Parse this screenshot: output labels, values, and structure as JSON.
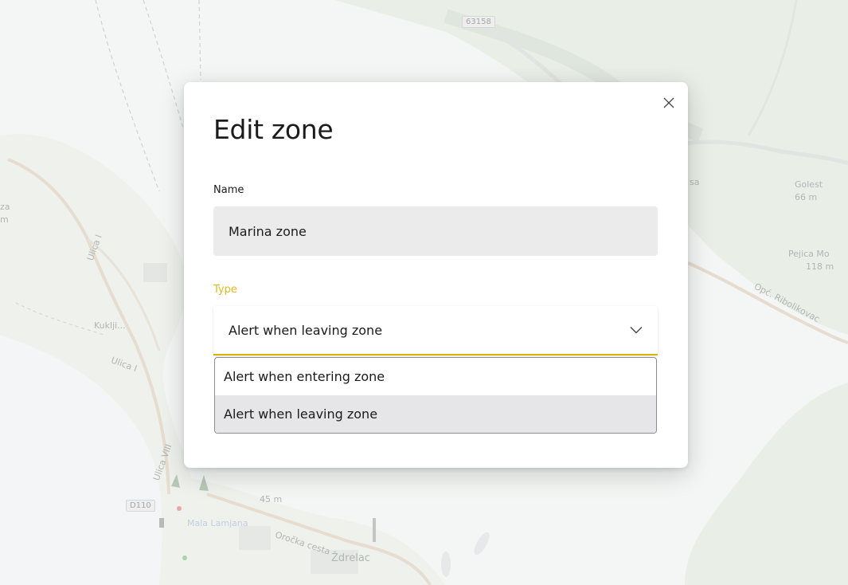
{
  "map": {
    "labels": {
      "road_63158": "63158",
      "kuklijca": "Kuklji...",
      "ulica_1": "Ulica I",
      "ulica_2": "Ulica I",
      "ulica_3": "Ulica VIII",
      "za": "za",
      "m": "m",
      "golest": "Golest",
      "golest_elev": "66 m",
      "pejica": "Pejica Mo",
      "pejica_elev": "118 m",
      "opc_road": "Opć. Ribolikovac",
      "sa": "sa",
      "d110": "D110",
      "elev_45": "45 m",
      "mala_lamjana": "Mala Lamjana",
      "orocka_cesta": "Oročka cesta",
      "zdrelac": "Ždrelac"
    }
  },
  "dialog": {
    "title": "Edit zone",
    "name_label": "Name",
    "name_value": "Marina zone",
    "type_label": "Type",
    "type_selected": "Alert when leaving zone",
    "type_options": [
      "Alert when entering zone",
      "Alert when leaving zone"
    ],
    "accent_color": "#d9b700",
    "close_icon": "close-icon",
    "chevron_icon": "chevron-down-icon"
  }
}
